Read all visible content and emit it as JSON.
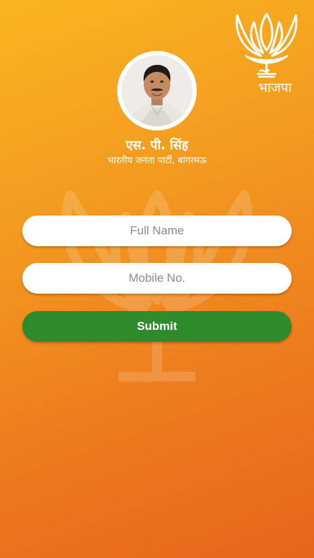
{
  "header": {
    "logo_icon": "lotus-icon",
    "logo_text": "भाजपा"
  },
  "profile": {
    "avatar_icon": "person-avatar",
    "name": "एस. पी. सिंह",
    "subtitle": "भारतीय जनता पार्टी, बांगरमऊ"
  },
  "form": {
    "full_name_placeholder": "Full Name",
    "full_name_value": "",
    "mobile_placeholder": "Mobile No.",
    "mobile_value": "",
    "submit_label": "Submit"
  },
  "colors": {
    "background_top": "#f9b521",
    "background_bottom": "#e8651b",
    "submit_button": "#2e8b2b",
    "field_background": "#ffffff"
  }
}
